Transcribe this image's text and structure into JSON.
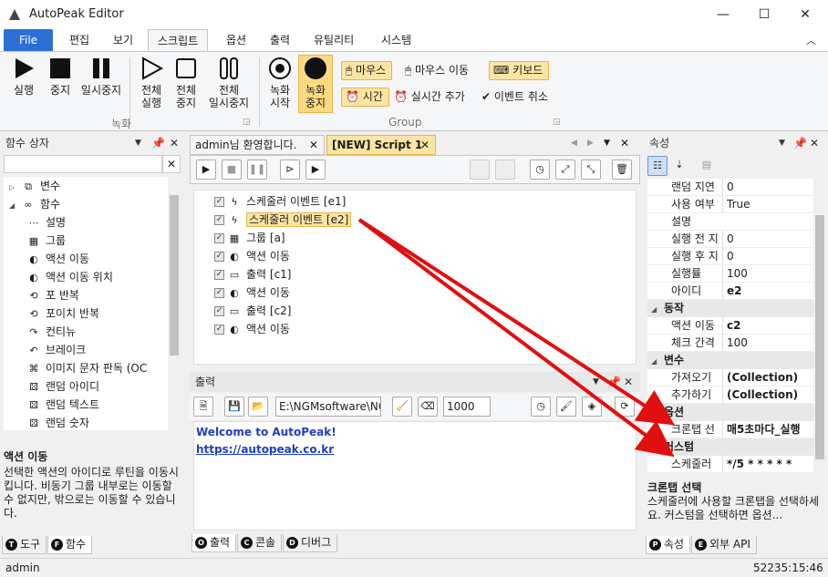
{
  "app": {
    "title": "AutoPeak Editor"
  },
  "menu": {
    "items": [
      "File",
      "편집",
      "보기",
      "스크립트",
      "옵션",
      "출력",
      "유틸리티",
      "시스템"
    ]
  },
  "ribbon": {
    "play": "실행",
    "stop": "중지",
    "pause": "일시중지",
    "run_all": "전체\n실행",
    "stop_all": "전체\n중지",
    "pause_all": "전체\n일시중지",
    "record_start": "녹화\n시작",
    "record_stop": "녹화\n중지",
    "group1_label": "녹화",
    "group2_label": "Group",
    "mouse": "마우스",
    "mouse_move": "마우스 이동",
    "keyboard": "키보드",
    "time": "시간",
    "realtime_add": "실시간 추가",
    "event_cancel": "이벤트 취소"
  },
  "left_panel": {
    "title": "함수 상자",
    "tree": [
      {
        "label": "변수",
        "icon": "variable-icon",
        "indent": 0,
        "expander": "▷"
      },
      {
        "label": "함수",
        "icon": "function-icon",
        "indent": 0,
        "expander": "◢"
      },
      {
        "label": "설명",
        "icon": "comment-icon",
        "indent": 1
      },
      {
        "label": "그룹",
        "icon": "group-icon",
        "indent": 1
      },
      {
        "label": "액션 이동",
        "icon": "action-move-icon",
        "indent": 1
      },
      {
        "label": "액션 이동 위치",
        "icon": "action-move-location-icon",
        "indent": 1
      },
      {
        "label": "포 반복",
        "icon": "for-loop-icon",
        "indent": 1
      },
      {
        "label": "포이치 반복",
        "icon": "foreach-loop-icon",
        "indent": 1
      },
      {
        "label": "컨티뉴",
        "icon": "continue-icon",
        "indent": 1
      },
      {
        "label": "브레이크",
        "icon": "break-icon",
        "indent": 1
      },
      {
        "label": "이미지 문자 판독 (OC",
        "icon": "ocr-icon",
        "indent": 1
      },
      {
        "label": "랜덤 아이디",
        "icon": "random-id-icon",
        "indent": 1
      },
      {
        "label": "랜덤 텍스트",
        "icon": "random-text-icon",
        "indent": 1
      },
      {
        "label": "랜덤 숫자",
        "icon": "random-number-icon",
        "indent": 1
      }
    ],
    "desc_title": "액션 이동",
    "desc_text": "선택한 액션의 아이디로 루틴을 이동시킵니다. 비동기 그룹 내부로는 이동할 수 없지만, 밖으로는 이동할 수 있습니다.",
    "tabs": [
      {
        "key": "T",
        "label": "도구"
      },
      {
        "key": "F",
        "label": "함수"
      }
    ]
  },
  "editor": {
    "tabs": [
      "admin님 환영합니다.",
      "[NEW] Script 1"
    ],
    "rows": [
      {
        "label": "스케줄러 이벤트 [e1]",
        "icon": "lightning-icon",
        "indent": 0
      },
      {
        "label": "스케줄러 이벤트 [e2]",
        "icon": "lightning-icon",
        "indent": 0,
        "selected": true
      },
      {
        "label": "그룹 [a]",
        "icon": "group-icon",
        "indent": 0
      },
      {
        "label": "액션 이동",
        "icon": "action-move-icon",
        "indent": 1
      },
      {
        "label": "출력 [c1]",
        "icon": "console-icon",
        "indent": 1
      },
      {
        "label": "액션 이동",
        "icon": "action-move-icon",
        "indent": 1
      },
      {
        "label": "출력 [c2]",
        "icon": "console-icon",
        "indent": 1
      },
      {
        "label": "액션 이동",
        "icon": "action-move-icon",
        "indent": 1
      }
    ]
  },
  "output": {
    "title": "출력",
    "path": "E:\\NGMsoftware\\NG",
    "number": "1000",
    "welcome": "Welcome to AutoPeak!",
    "link": "https://autopeak.co.kr",
    "tabs": [
      {
        "key": "O",
        "label": "출력"
      },
      {
        "key": "C",
        "label": "콘솔"
      },
      {
        "key": "D",
        "label": "디버그"
      }
    ]
  },
  "properties": {
    "title": "속성",
    "rows": [
      {
        "k": "랜덤 지연",
        "v": "0"
      },
      {
        "k": "사용 여부",
        "v": "True"
      },
      {
        "k": "설명",
        "v": ""
      },
      {
        "k": "실행 전 지",
        "v": "0"
      },
      {
        "k": "실행 후 지",
        "v": "0"
      },
      {
        "k": "실행률",
        "v": "100"
      },
      {
        "k": "아이디",
        "v": "e2",
        "bold": true
      },
      {
        "cat": "동작"
      },
      {
        "k": "액션 이동",
        "v": "c2",
        "bold": true
      },
      {
        "k": "체크 간격",
        "v": "100"
      },
      {
        "cat": "변수"
      },
      {
        "k": "가져오기",
        "v": "(Collection)",
        "bold": true
      },
      {
        "k": "추가하기",
        "v": "(Collection)",
        "bold": true
      },
      {
        "cat": "옵션"
      },
      {
        "k": "크론탭 선",
        "v": "매5초마다_실행",
        "bold": true
      },
      {
        "cat": "커스텀"
      },
      {
        "k": "스케줄러",
        "v": "*/5 * * * * *",
        "bold": true
      }
    ],
    "desc_title": "크론탭 선택",
    "desc_text": "스케줄러에 사용할 크론탭을 선택하세요. 커스텀을 선택하면 옵션...",
    "tabs": [
      {
        "key": "P",
        "label": "속성"
      },
      {
        "key": "E",
        "label": "외부 API"
      }
    ]
  },
  "status": {
    "user": "admin",
    "time": "52235:15:46"
  }
}
